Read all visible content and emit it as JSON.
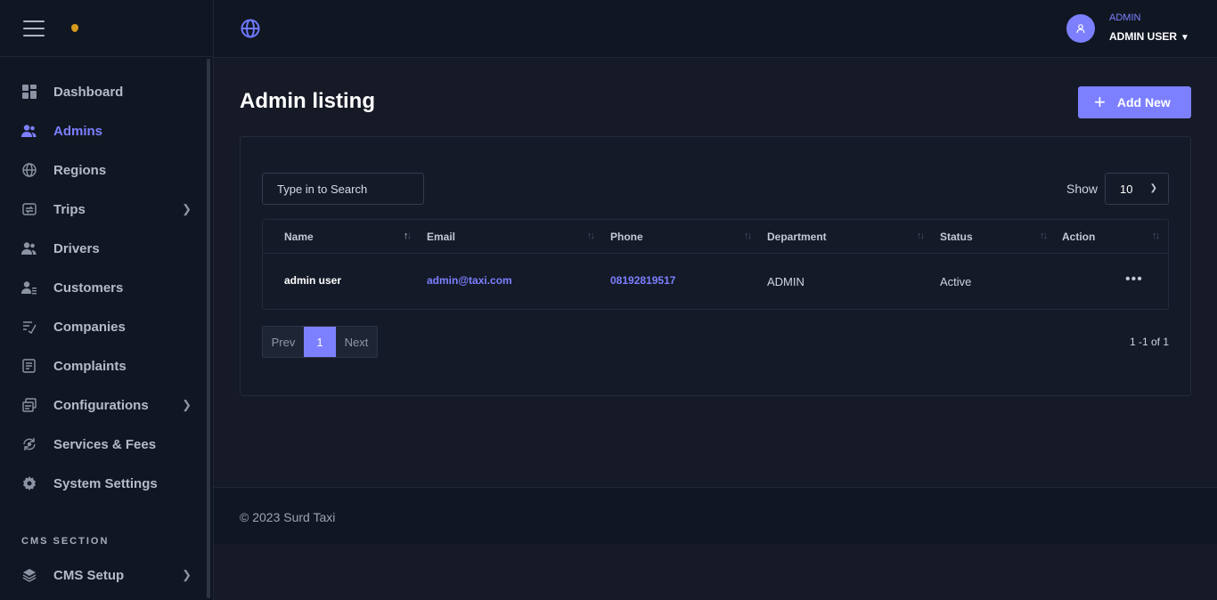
{
  "sidebar": {
    "items": [
      {
        "label": "Dashboard",
        "icon": "dashboard-icon"
      },
      {
        "label": "Admins",
        "icon": "users-icon",
        "active": true
      },
      {
        "label": "Regions",
        "icon": "globe-icon"
      },
      {
        "label": "Trips",
        "icon": "trips-icon",
        "has_children": true
      },
      {
        "label": "Drivers",
        "icon": "drivers-icon"
      },
      {
        "label": "Customers",
        "icon": "customers-icon"
      },
      {
        "label": "Companies",
        "icon": "companies-icon"
      },
      {
        "label": "Complaints",
        "icon": "complaints-icon"
      },
      {
        "label": "Configurations",
        "icon": "configurations-icon",
        "has_children": true
      },
      {
        "label": "Services & Fees",
        "icon": "services-icon"
      },
      {
        "label": "System Settings",
        "icon": "settings-icon"
      }
    ],
    "section_title": "CMS SECTION",
    "cms_item": {
      "label": "CMS Setup",
      "icon": "layers-icon",
      "has_children": true
    }
  },
  "topbar": {
    "user_role": "ADMIN",
    "user_name": "ADMIN USER"
  },
  "main": {
    "title": "Admin listing",
    "add_button": "Add New",
    "search_placeholder": "Type in to Search",
    "show_label": "Show",
    "show_value": "10",
    "columns": [
      "Name",
      "Email",
      "Phone",
      "Department",
      "Status",
      "Action"
    ],
    "rows": [
      {
        "name": "admin user",
        "email": "admin@taxi.com",
        "phone": "08192819517",
        "department": "ADMIN",
        "status": "Active"
      }
    ],
    "pagination": {
      "prev": "Prev",
      "page": "1",
      "next": "Next",
      "range": "1 -1 of 1"
    }
  },
  "footer": {
    "text": "© 2023 Surd Taxi"
  },
  "colors": {
    "accent": "#7c80ff",
    "background": "#151a26",
    "sidebar": "#111722"
  }
}
